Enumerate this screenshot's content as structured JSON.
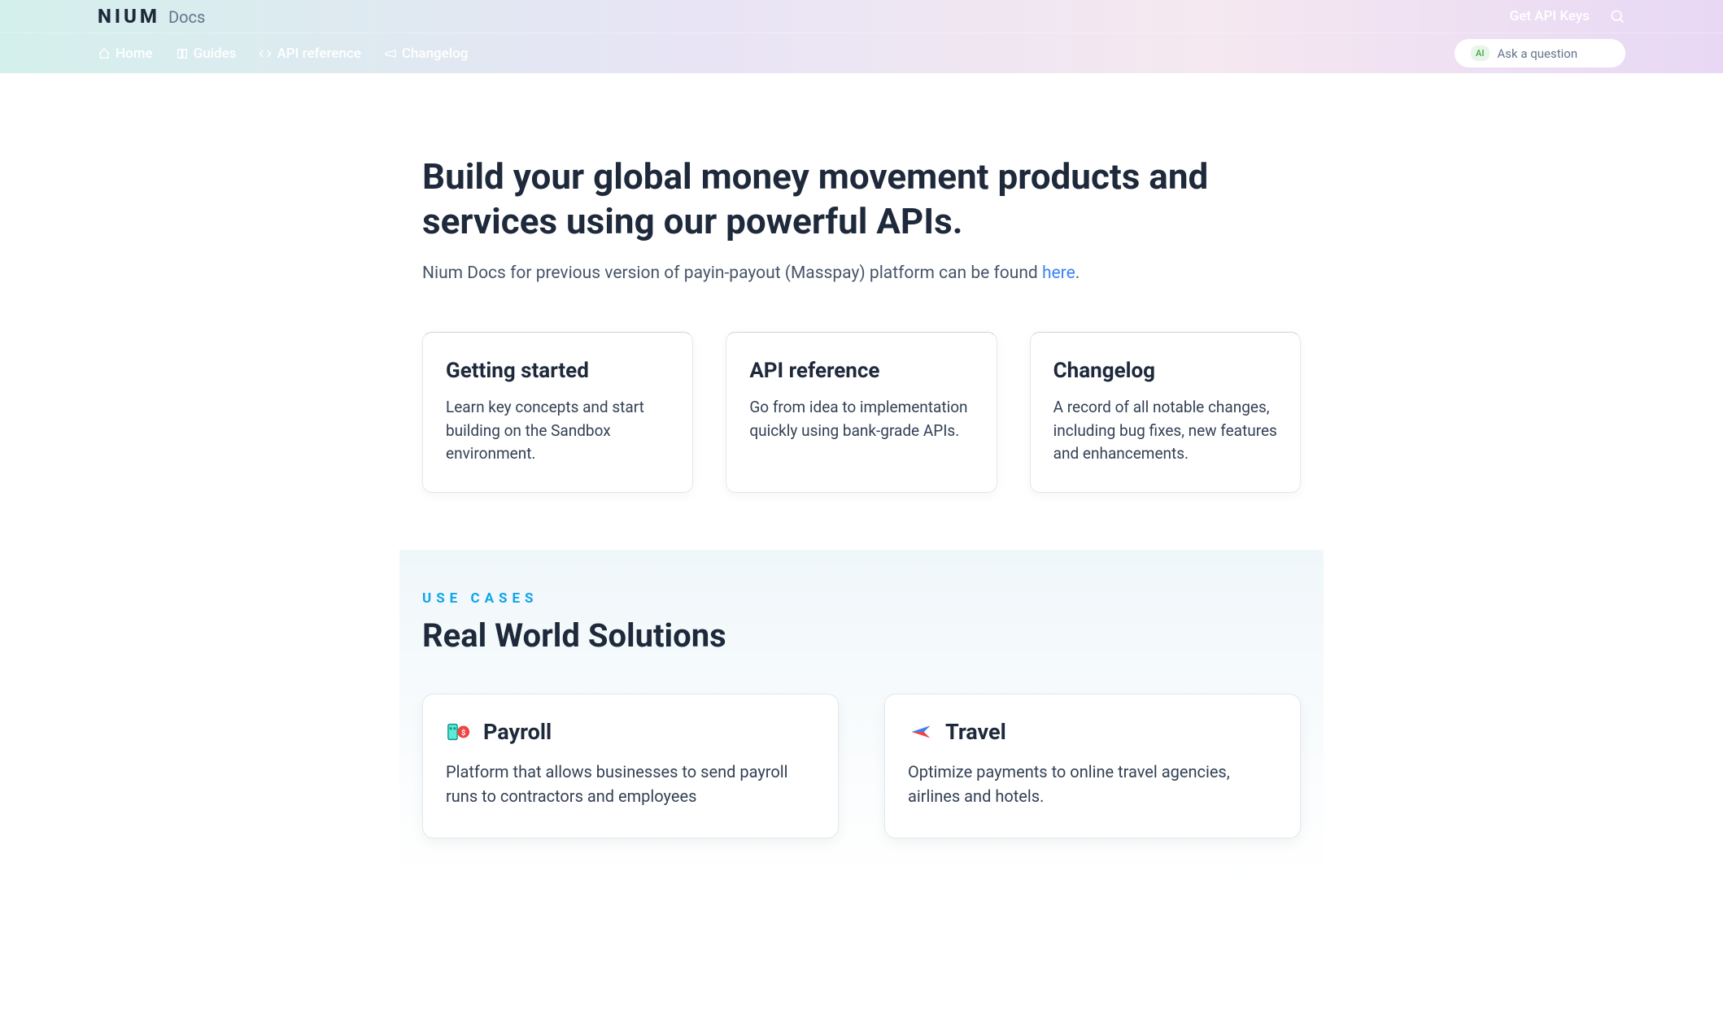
{
  "header": {
    "logo": "NIUM",
    "logo_sub": "Docs",
    "get_api_keys": "Get API Keys"
  },
  "nav": {
    "items": [
      {
        "label": "Home",
        "icon": "home-icon"
      },
      {
        "label": "Guides",
        "icon": "book-icon"
      },
      {
        "label": "API reference",
        "icon": "code-icon"
      },
      {
        "label": "Changelog",
        "icon": "megaphone-icon"
      }
    ],
    "ask_badge": "AI",
    "ask_placeholder": "Ask a question"
  },
  "hero": {
    "title": "Build your global money movement products and services using our powerful APIs.",
    "subtitle_prefix": "Nium Docs for previous version of payin-payout (Masspay) platform can be found ",
    "subtitle_link": "here",
    "subtitle_suffix": "."
  },
  "cards": [
    {
      "title": "Getting started",
      "desc": "Learn key concepts and start building on the Sandbox environment."
    },
    {
      "title": "API reference",
      "desc": "Go from idea to implementation quickly using bank-grade APIs."
    },
    {
      "title": "Changelog",
      "desc": "A record of all notable changes, including bug fixes, new features and enhancements."
    }
  ],
  "use_cases": {
    "label": "USE CASES",
    "title": "Real World Solutions",
    "items": [
      {
        "icon": "payroll-icon",
        "title": "Payroll",
        "desc": "Platform that allows businesses to send payroll runs to contractors and employees"
      },
      {
        "icon": "travel-icon",
        "title": "Travel",
        "desc": "Optimize payments to online travel agencies, airlines and hotels."
      }
    ]
  }
}
